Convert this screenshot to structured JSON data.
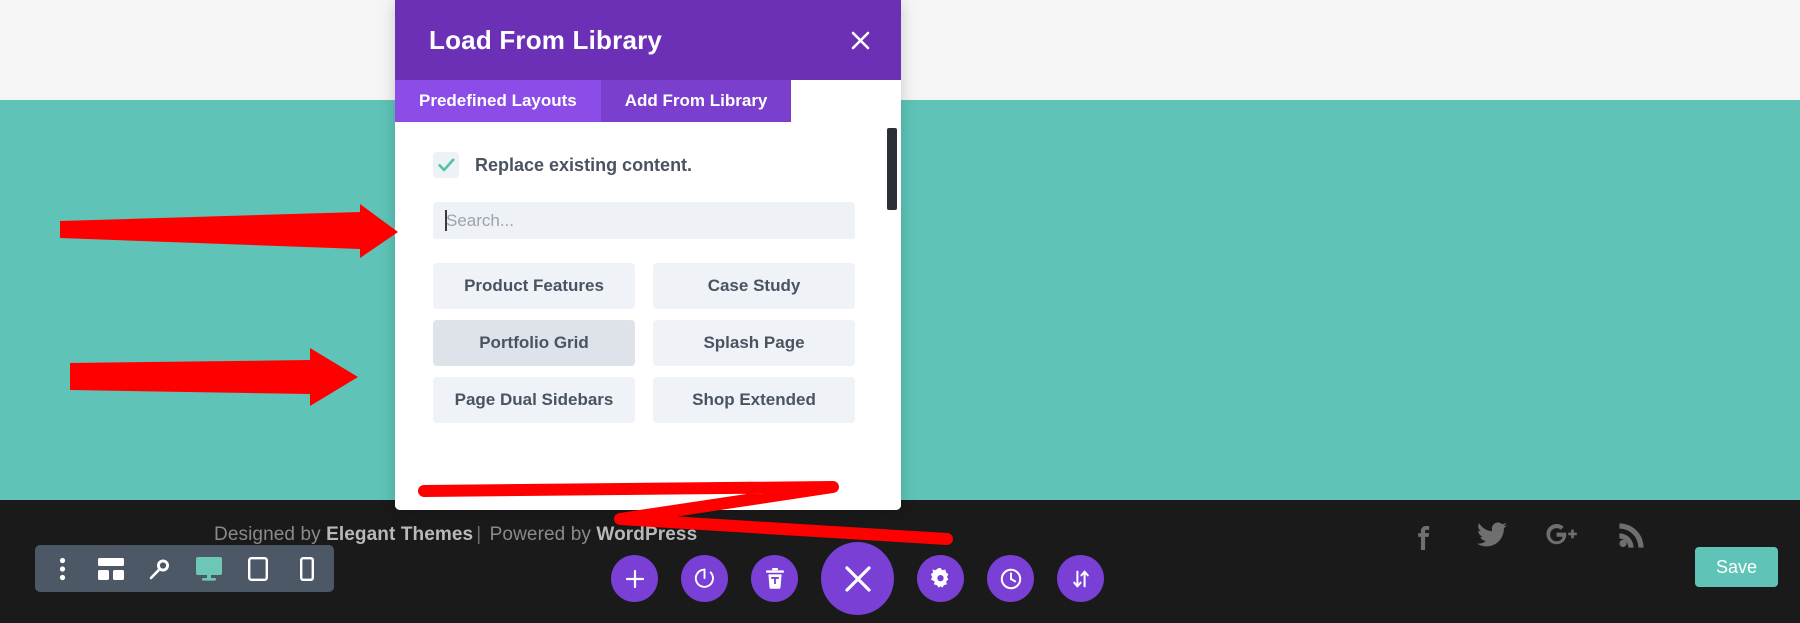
{
  "theme": {
    "teal": "#5fc3b8",
    "purple_header": "#6b30b5",
    "purple_tab_active": "#8b4ce8",
    "purple_tab_inactive": "#7b3fce",
    "purple_action": "#7a3fd4",
    "footer_dark": "#1a1a1a",
    "annotation_red": "#ff0000"
  },
  "modal": {
    "title": "Load From Library",
    "close_label": "×",
    "tabs": [
      {
        "label": "Predefined Layouts",
        "active": true
      },
      {
        "label": "Add From Library",
        "active": false
      }
    ],
    "checkbox": {
      "label": "Replace existing content.",
      "checked": true
    },
    "search": {
      "placeholder": "Search...",
      "value": "",
      "focused": true
    },
    "layouts": [
      {
        "label": "Product Features",
        "hover": false
      },
      {
        "label": "Case Study",
        "hover": false
      },
      {
        "label": "Portfolio Grid",
        "hover": true
      },
      {
        "label": "Splash Page",
        "hover": false
      },
      {
        "label": "Page Dual Sidebars",
        "hover": false
      },
      {
        "label": "Shop Extended",
        "hover": false
      }
    ]
  },
  "footer": {
    "credit_prefix": "Designed by ",
    "credit_brand": "Elegant Themes",
    "credit_separator": "|",
    "credit_middle": " Powered by ",
    "credit_platform": "WordPress",
    "social": [
      {
        "name": "facebook-icon"
      },
      {
        "name": "twitter-icon"
      },
      {
        "name": "google-plus-icon"
      },
      {
        "name": "rss-icon"
      }
    ],
    "save_label": "Save"
  },
  "viewport_bar": {
    "items": [
      {
        "name": "more-options-icon",
        "active": false
      },
      {
        "name": "wireframe-icon",
        "active": false
      },
      {
        "name": "zoom-icon",
        "active": false
      },
      {
        "name": "desktop-icon",
        "active": true
      },
      {
        "name": "tablet-icon",
        "active": false
      },
      {
        "name": "mobile-icon",
        "active": false
      }
    ]
  },
  "action_bar": {
    "items": [
      {
        "name": "add-icon",
        "big": false
      },
      {
        "name": "power-icon",
        "big": false
      },
      {
        "name": "trash-icon",
        "big": false
      },
      {
        "name": "close-icon",
        "big": true
      },
      {
        "name": "settings-icon",
        "big": false
      },
      {
        "name": "history-icon",
        "big": false
      },
      {
        "name": "sort-icon",
        "big": false
      }
    ]
  },
  "annotations": [
    {
      "name": "arrow-to-search-field"
    },
    {
      "name": "arrow-to-layout-list"
    },
    {
      "name": "scribble-over-modal-bottom"
    }
  ]
}
